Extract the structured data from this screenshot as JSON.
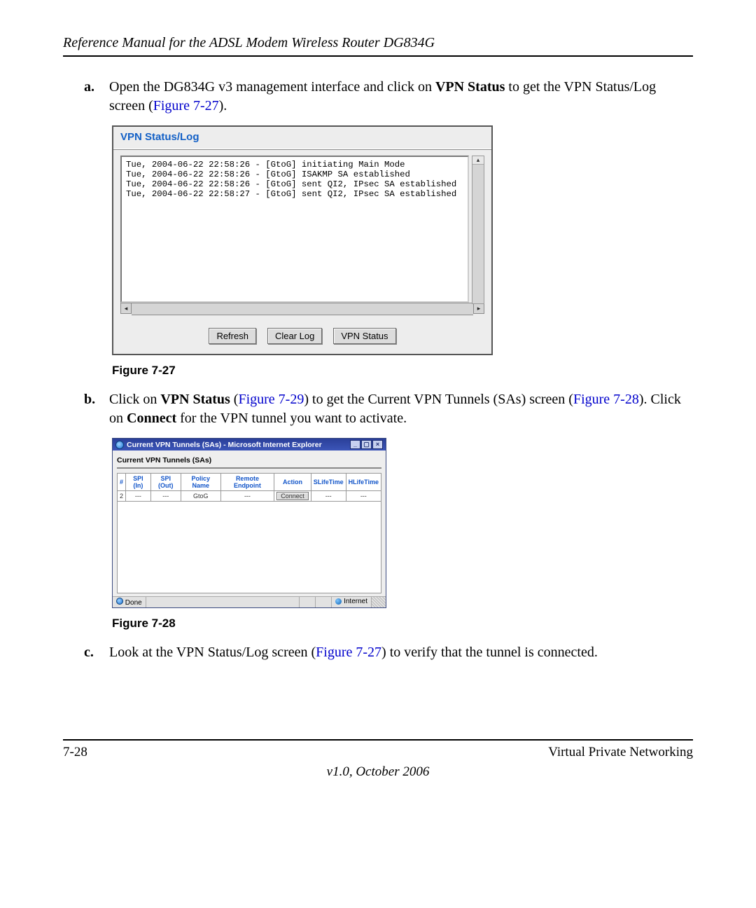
{
  "header": {
    "title": "Reference Manual for the ADSL Modem Wireless Router DG834G"
  },
  "step_a": {
    "label": "a.",
    "pre": "Open the DG834G v3 management interface and click on ",
    "bold1": "VPN Status",
    "mid": " to get the VPN Status/Log screen (",
    "figref": "Figure 7-27",
    "post": ")."
  },
  "fig27": {
    "panel_title": "VPN Status/Log",
    "log_lines": [
      "Tue, 2004-06-22 22:58:26 - [GtoG] initiating Main Mode",
      "Tue, 2004-06-22 22:58:26 - [GtoG] ISAKMP SA established",
      "Tue, 2004-06-22 22:58:26 - [GtoG] sent QI2, IPsec SA established",
      "Tue, 2004-06-22 22:58:27 - [GtoG] sent QI2, IPsec SA established"
    ],
    "btn_refresh": "Refresh",
    "btn_clear": "Clear Log",
    "btn_status": "VPN Status",
    "caption": "Figure 7-27"
  },
  "step_b": {
    "label": "b.",
    "pre": "Click on ",
    "bold1": "VPN Status",
    "mid1": " (",
    "figref1": "Figure 7-29",
    "mid2": ") to get the Current VPN Tunnels (SAs) screen (",
    "figref2": "Figure 7-28",
    "mid3": "). Click on ",
    "bold2": "Connect",
    "post": " for the VPN tunnel you want to activate."
  },
  "fig28": {
    "window_title": "Current VPN Tunnels (SAs) - Microsoft Internet Explorer",
    "subtitle": "Current VPN Tunnels (SAs)",
    "headers": [
      "#",
      "SPI (In)",
      "SPI (Out)",
      "Policy Name",
      "Remote Endpoint",
      "Action",
      "SLifeTime",
      "HLifeTime"
    ],
    "row": {
      "num": "2",
      "spi_in": "---",
      "spi_out": "---",
      "policy": "GtoG",
      "endpoint": "---",
      "action": "Connect",
      "slife": "---",
      "hlife": "---"
    },
    "status_done": "Done",
    "status_zone": "Internet",
    "caption": "Figure 7-28"
  },
  "step_c": {
    "label": "c.",
    "pre": "Look at the VPN Status/Log screen (",
    "figref": "Figure 7-27",
    "post": ") to verify that the tunnel is connected."
  },
  "footer": {
    "page_no": "7-28",
    "section": "Virtual Private Networking",
    "version": "v1.0, October 2006"
  }
}
